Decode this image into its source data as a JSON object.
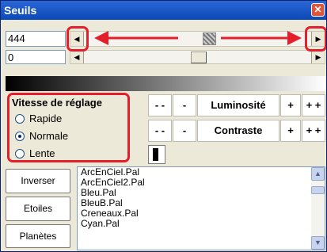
{
  "window": {
    "title": "Seuils",
    "close_glyph": "✕"
  },
  "fields": {
    "top_value": "444",
    "bottom_value": "0"
  },
  "scroll": {
    "left_arrow": "◀",
    "right_arrow": "▶",
    "up_arrow": "▲",
    "down_arrow": "▼"
  },
  "speed": {
    "title": "Vitesse de réglage",
    "options": [
      "Rapide",
      "Normale",
      "Lente"
    ],
    "selected": "Normale"
  },
  "adjust": {
    "minus2": "- -",
    "minus1": "-",
    "plus1": "+",
    "plus2": "+ +",
    "luminosity_label": "Luminosité",
    "contrast_label": "Contraste"
  },
  "actions": {
    "invert": "Inverser",
    "stars": "Etoiles",
    "planets": "Planètes"
  },
  "palettes": [
    "ArcEnCiel.Pal",
    "ArcEnCiel2.Pal",
    "Bleu.Pal",
    "BleuB.Pal",
    "Creneaux.Pal",
    "Cyan.Pal"
  ],
  "colors": {
    "title_bar": "#0b49b9",
    "highlight": "#e41e2b",
    "window_bg": "#ece9d8"
  }
}
